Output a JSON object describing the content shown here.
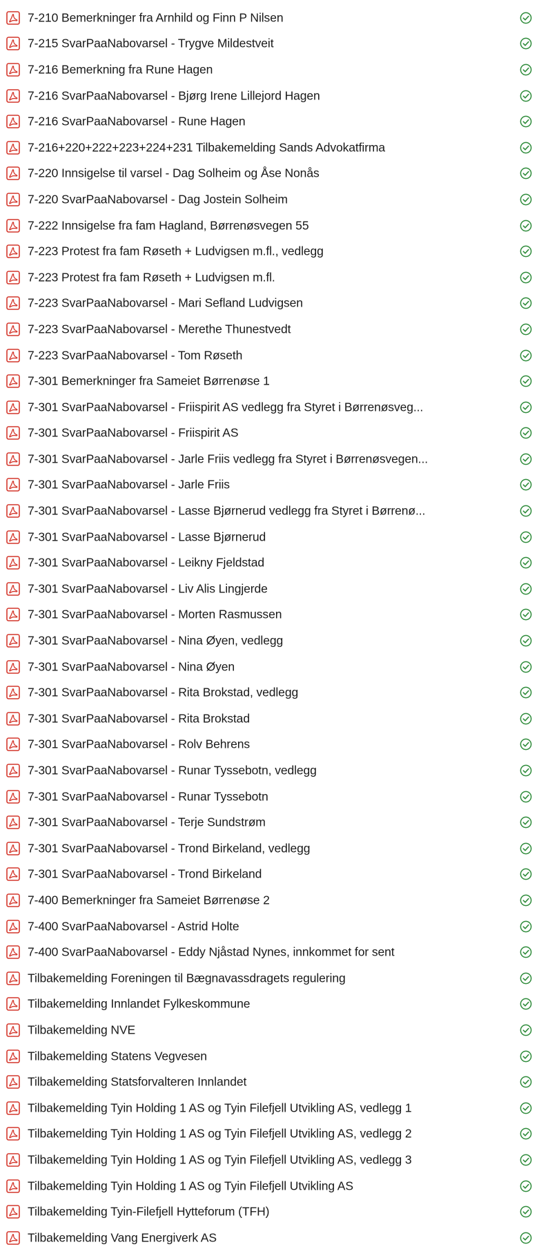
{
  "colors": {
    "pdf_icon_red": "#d4362b",
    "status_green": "#2e8b3a",
    "text": "#1a1a1a"
  },
  "icons": {
    "file_type": "pdf-file-icon",
    "status": "available-status-check-icon"
  },
  "files": [
    "7-210 Bemerkninger fra Arnhild og Finn P Nilsen",
    "7-215 SvarPaaNabovarsel - Trygve Mildestveit",
    "7-216 Bemerkning fra Rune Hagen",
    "7-216 SvarPaaNabovarsel - Bjørg Irene Lillejord Hagen",
    "7-216 SvarPaaNabovarsel - Rune Hagen",
    "7-216+220+222+223+224+231 Tilbakemelding Sands Advokatfirma",
    "7-220 Innsigelse til varsel - Dag Solheim og Åse Nonås",
    "7-220 SvarPaaNabovarsel - Dag Jostein Solheim",
    "7-222 Innsigelse fra fam Hagland, Børrenøsvegen 55",
    "7-223 Protest fra fam Røseth + Ludvigsen m.fl., vedlegg",
    "7-223 Protest fra fam Røseth + Ludvigsen m.fl.",
    "7-223 SvarPaaNabovarsel - Mari Sefland Ludvigsen",
    "7-223 SvarPaaNabovarsel - Merethe Thunestvedt",
    "7-223 SvarPaaNabovarsel - Tom Røseth",
    "7-301 Bemerkninger fra Sameiet Børrenøse 1",
    "7-301 SvarPaaNabovarsel - Friispirit AS vedlegg fra Styret i Børrenøsveg...",
    "7-301 SvarPaaNabovarsel - Friispirit AS",
    "7-301 SvarPaaNabovarsel - Jarle Friis vedlegg fra Styret i Børrenøsvegen...",
    "7-301 SvarPaaNabovarsel - Jarle Friis",
    "7-301 SvarPaaNabovarsel - Lasse Bjørnerud vedlegg fra Styret i Børrenø...",
    "7-301 SvarPaaNabovarsel - Lasse Bjørnerud",
    "7-301 SvarPaaNabovarsel - Leikny Fjeldstad",
    "7-301 SvarPaaNabovarsel - Liv Alis Lingjerde",
    "7-301 SvarPaaNabovarsel - Morten Rasmussen",
    "7-301 SvarPaaNabovarsel - Nina Øyen, vedlegg",
    "7-301 SvarPaaNabovarsel - Nina Øyen",
    "7-301 SvarPaaNabovarsel - Rita Brokstad, vedlegg",
    "7-301 SvarPaaNabovarsel - Rita Brokstad",
    "7-301 SvarPaaNabovarsel - Rolv Behrens",
    "7-301 SvarPaaNabovarsel - Runar Tyssebotn, vedlegg",
    "7-301 SvarPaaNabovarsel - Runar Tyssebotn",
    "7-301 SvarPaaNabovarsel - Terje Sundstrøm",
    "7-301 SvarPaaNabovarsel - Trond Birkeland, vedlegg",
    "7-301 SvarPaaNabovarsel - Trond Birkeland",
    "7-400 Bemerkninger fra Sameiet Børrenøse 2",
    "7-400 SvarPaaNabovarsel - Astrid Holte",
    "7-400 SvarPaaNabovarsel - Eddy Njåstad Nynes, innkommet for sent",
    "Tilbakemelding Foreningen til Bægnavassdragets regulering",
    "Tilbakemelding Innlandet Fylkeskommune",
    "Tilbakemelding NVE",
    "Tilbakemelding Statens Vegvesen",
    "Tilbakemelding Statsforvalteren Innlandet",
    "Tilbakemelding Tyin Holding 1 AS og Tyin Filefjell Utvikling AS, vedlegg 1",
    "Tilbakemelding Tyin Holding 1 AS og Tyin Filefjell Utvikling AS, vedlegg 2",
    "Tilbakemelding Tyin Holding 1 AS og Tyin Filefjell Utvikling AS, vedlegg 3",
    "Tilbakemelding Tyin Holding 1 AS og Tyin Filefjell Utvikling AS",
    "Tilbakemelding Tyin-Filefjell Hytteforum (TFH)",
    "Tilbakemelding Vang Energiverk AS"
  ]
}
